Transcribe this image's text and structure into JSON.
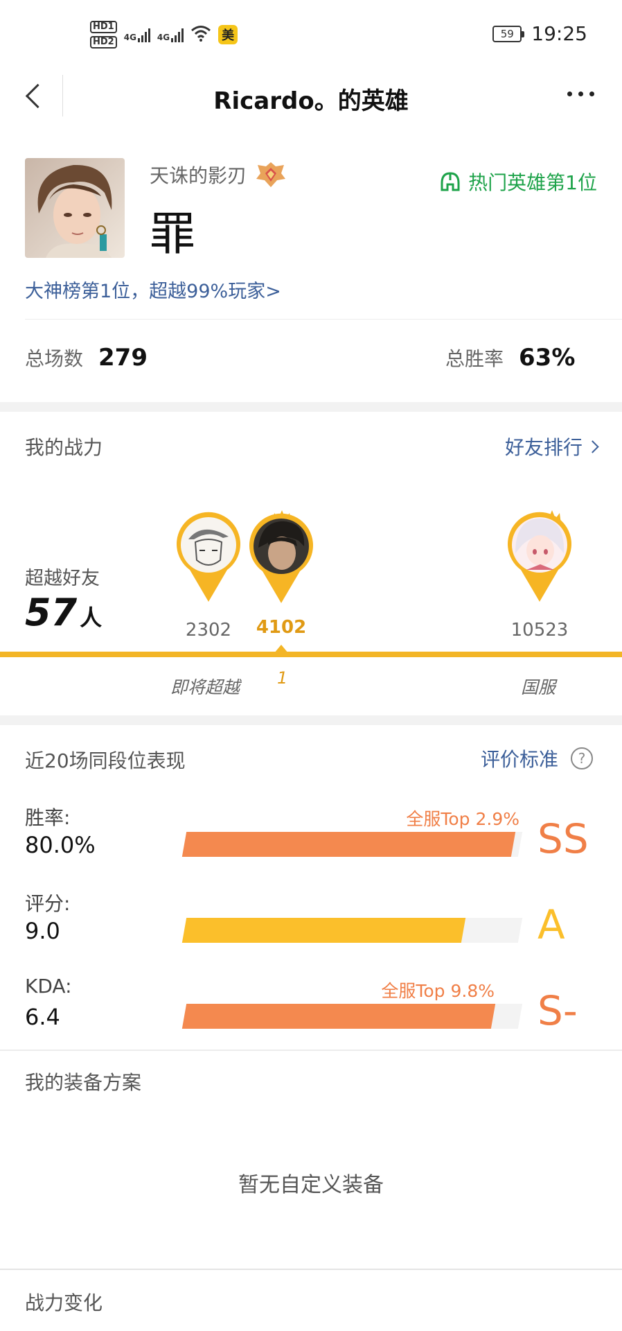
{
  "status_bar": {
    "hd1": "HD1",
    "hd2": "HD2",
    "net1": "4G",
    "net2": "4G",
    "mei_badge": "美",
    "battery": "59",
    "time": "19:25"
  },
  "nav": {
    "title": "Ricardo。的英雄"
  },
  "hero": {
    "subtitle": "天诛的影刃",
    "name": "罪",
    "hot_tag": "热门英雄第1位",
    "rank_link": "大神榜第1位，超越99%玩家>"
  },
  "stats": {
    "total_games_label": "总场数",
    "total_games_value": "279",
    "win_rate_label": "总胜率",
    "win_rate_value": "63%"
  },
  "power": {
    "title": "我的战力",
    "friends_rank_link": "好友排行",
    "surpass_label": "超越好友",
    "surpass_count": "57",
    "surpass_unit": "人",
    "players": [
      {
        "score": "2302",
        "label": "即将超越"
      },
      {
        "score": "4102",
        "rank": "1"
      },
      {
        "score": "10523",
        "label": "国服"
      }
    ],
    "colors": {
      "accent": "#f3b526",
      "me": "#e09a14"
    }
  },
  "performance": {
    "title": "近20场同段位表现",
    "criteria_link": "评价标准",
    "help_symbol": "?",
    "rows": [
      {
        "label": "胜率:",
        "value": "80.0%",
        "bar_fraction": 0.98,
        "note": "全服Top 2.9%",
        "grade": "SS",
        "color": "#f4894f"
      },
      {
        "label": "评分:",
        "value": "9.0",
        "bar_fraction": 0.83,
        "note": "",
        "grade": "A",
        "color": "#fbbf2b"
      },
      {
        "label": "KDA:",
        "value": "6.4",
        "bar_fraction": 0.92,
        "note": "全服Top 9.8%",
        "grade": "S-",
        "color": "#f4894f"
      }
    ]
  },
  "equipment": {
    "title": "我的装备方案",
    "empty": "暂无自定义装备"
  },
  "power_change": {
    "title": "战力变化"
  }
}
